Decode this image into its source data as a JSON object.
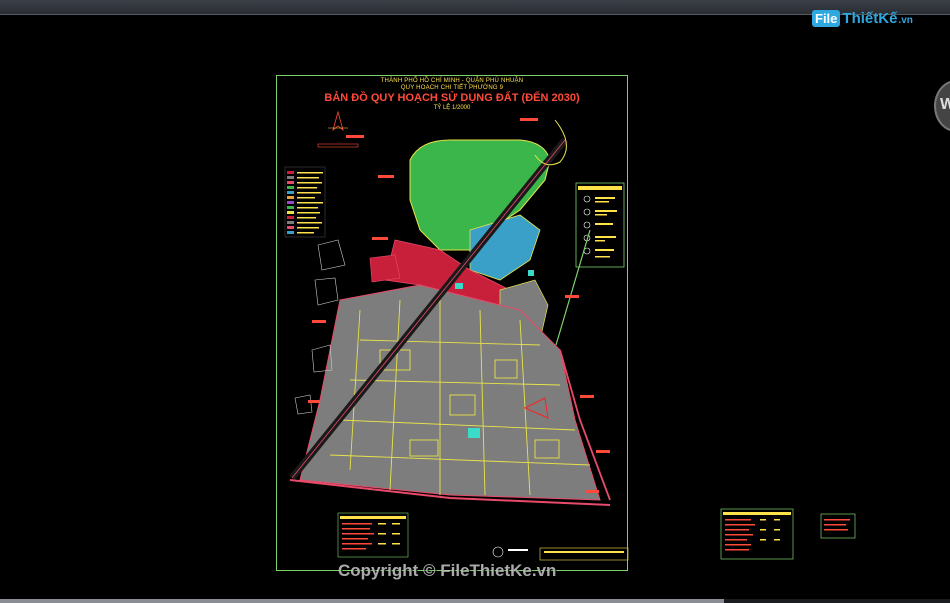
{
  "logo": {
    "box_text": "File",
    "name_text": "ThiếtKế",
    "suffix_text": ".vn"
  },
  "drawing": {
    "line1": "THÀNH PHỐ HỒ CHÍ MINH - QUẬN PHÚ NHUẬN",
    "line2": "QUY HOẠCH CHI TIẾT PHƯỜNG 9",
    "title": "BẢN ĐỒ QUY HOẠCH SỬ DỤNG ĐẤT (ĐẾN 2030)",
    "scale": "TỶ LỆ   1/2000"
  },
  "watermark": {
    "text": "Copyright © FileThietKe.vn"
  },
  "side_badge": {
    "text": "W"
  },
  "colors": {
    "frame": "#7fd36b",
    "title_red": "#ff4a3a",
    "text_yellow": "#ffe14a",
    "park_green": "#3bb64a",
    "residential_gray": "#7d7d7d",
    "road_yellow": "#e8e34a",
    "commercial_red": "#c8203a",
    "water_cyan": "#3aa0c8",
    "logo_blue": "#2fa7e0"
  }
}
